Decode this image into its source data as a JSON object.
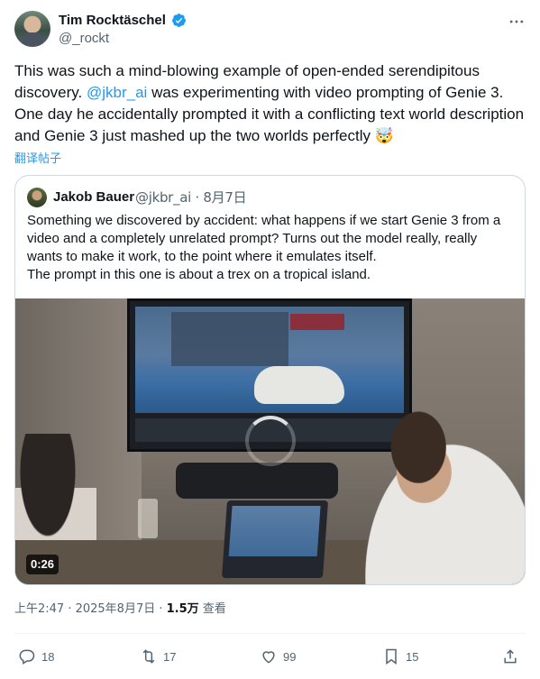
{
  "author": {
    "name": "Tim Rocktäschel",
    "handle": "@_rockt"
  },
  "tweet": {
    "text_before": "This was such a mind-blowing example of open-ended serendipitous discovery. ",
    "mention": "@jkbr_ai",
    "text_after": " was experimenting with video prompting of Genie 3. One day he accidentally prompted it with a conflicting text world description and Genie 3 just mashed up the two worlds perfectly 🤯",
    "translate_label": "翻译帖子"
  },
  "quote": {
    "name": "Jakob Bauer",
    "handle": "@jkbr_ai",
    "date": "· 8月7日",
    "lines": [
      "Something we discovered by accident: what happens if we start Genie 3 from a video and a completely unrelated prompt? Turns out the model really, really wants to make it work, to the point where it emulates itself.",
      "The prompt in this one is about a trex on a tropical island."
    ],
    "video_time": "0:26"
  },
  "meta": {
    "time": "上午2:47 · 2025年8月7日 · ",
    "views": "1.5万",
    "views_label": " 查看"
  },
  "actions": {
    "replies": "18",
    "reposts": "17",
    "likes": "99",
    "bookmarks": "15"
  },
  "colors": {
    "accent": "#1d9bf0",
    "muted": "#536471"
  },
  "icons": [
    "verified-icon",
    "more-icon",
    "reply-icon",
    "repost-icon",
    "like-icon",
    "bookmark-icon",
    "share-icon"
  ]
}
